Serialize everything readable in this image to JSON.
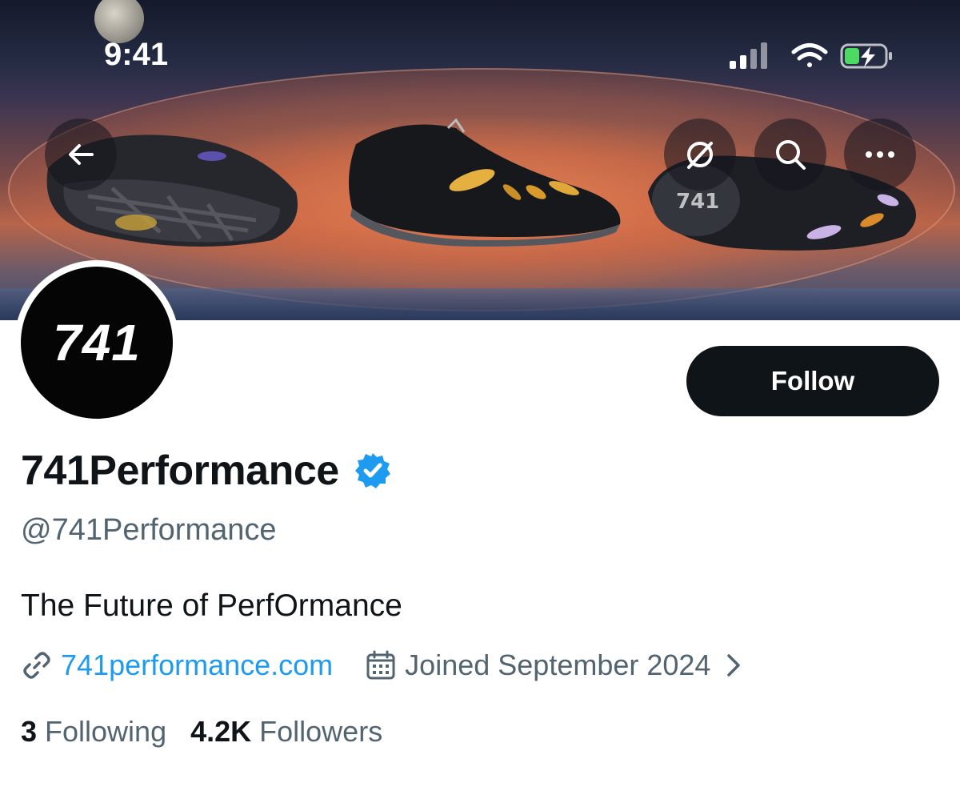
{
  "status_bar": {
    "time": "9:41"
  },
  "banner": {
    "shoe_logo_text": "741"
  },
  "profile": {
    "avatar_text": "741",
    "follow_label": "Follow",
    "display_name": "741Performance",
    "handle": "@741Performance",
    "bio": "The Future of PerfOrmance",
    "website": "741performance.com",
    "joined": "Joined September 2024",
    "following_count": "3",
    "following_label": "Following",
    "followers_count": "4.2K",
    "followers_label": "Followers"
  },
  "colors": {
    "accent": "#1d9bf0",
    "text": "#0f1419",
    "secondary": "#536471",
    "battery": "#4cd964"
  },
  "icons": [
    "back-arrow-icon",
    "grok-icon",
    "search-icon",
    "more-icon",
    "verified-icon",
    "link-icon",
    "calendar-icon",
    "chevron-right-icon"
  ]
}
